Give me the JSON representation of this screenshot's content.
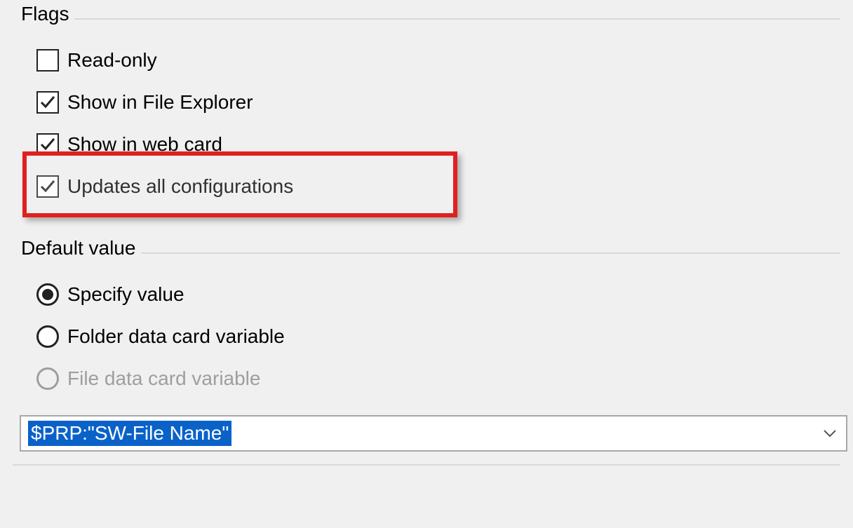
{
  "flags": {
    "legend": "Flags",
    "items": [
      {
        "label": "Read-only",
        "checked": false
      },
      {
        "label": "Show in File Explorer",
        "checked": true
      },
      {
        "label": "Show in web card",
        "checked": true
      },
      {
        "label": "Updates all configurations",
        "checked": true,
        "highlighted": true
      }
    ]
  },
  "default_value": {
    "legend": "Default value",
    "options": [
      {
        "label": "Specify value",
        "selected": true,
        "disabled": false
      },
      {
        "label": "Folder data card variable",
        "selected": false,
        "disabled": false
      },
      {
        "label": "File data card variable",
        "selected": false,
        "disabled": true
      }
    ],
    "combo_value": "$PRP:\"SW-File Name\""
  },
  "highlight_color": "#e02020"
}
